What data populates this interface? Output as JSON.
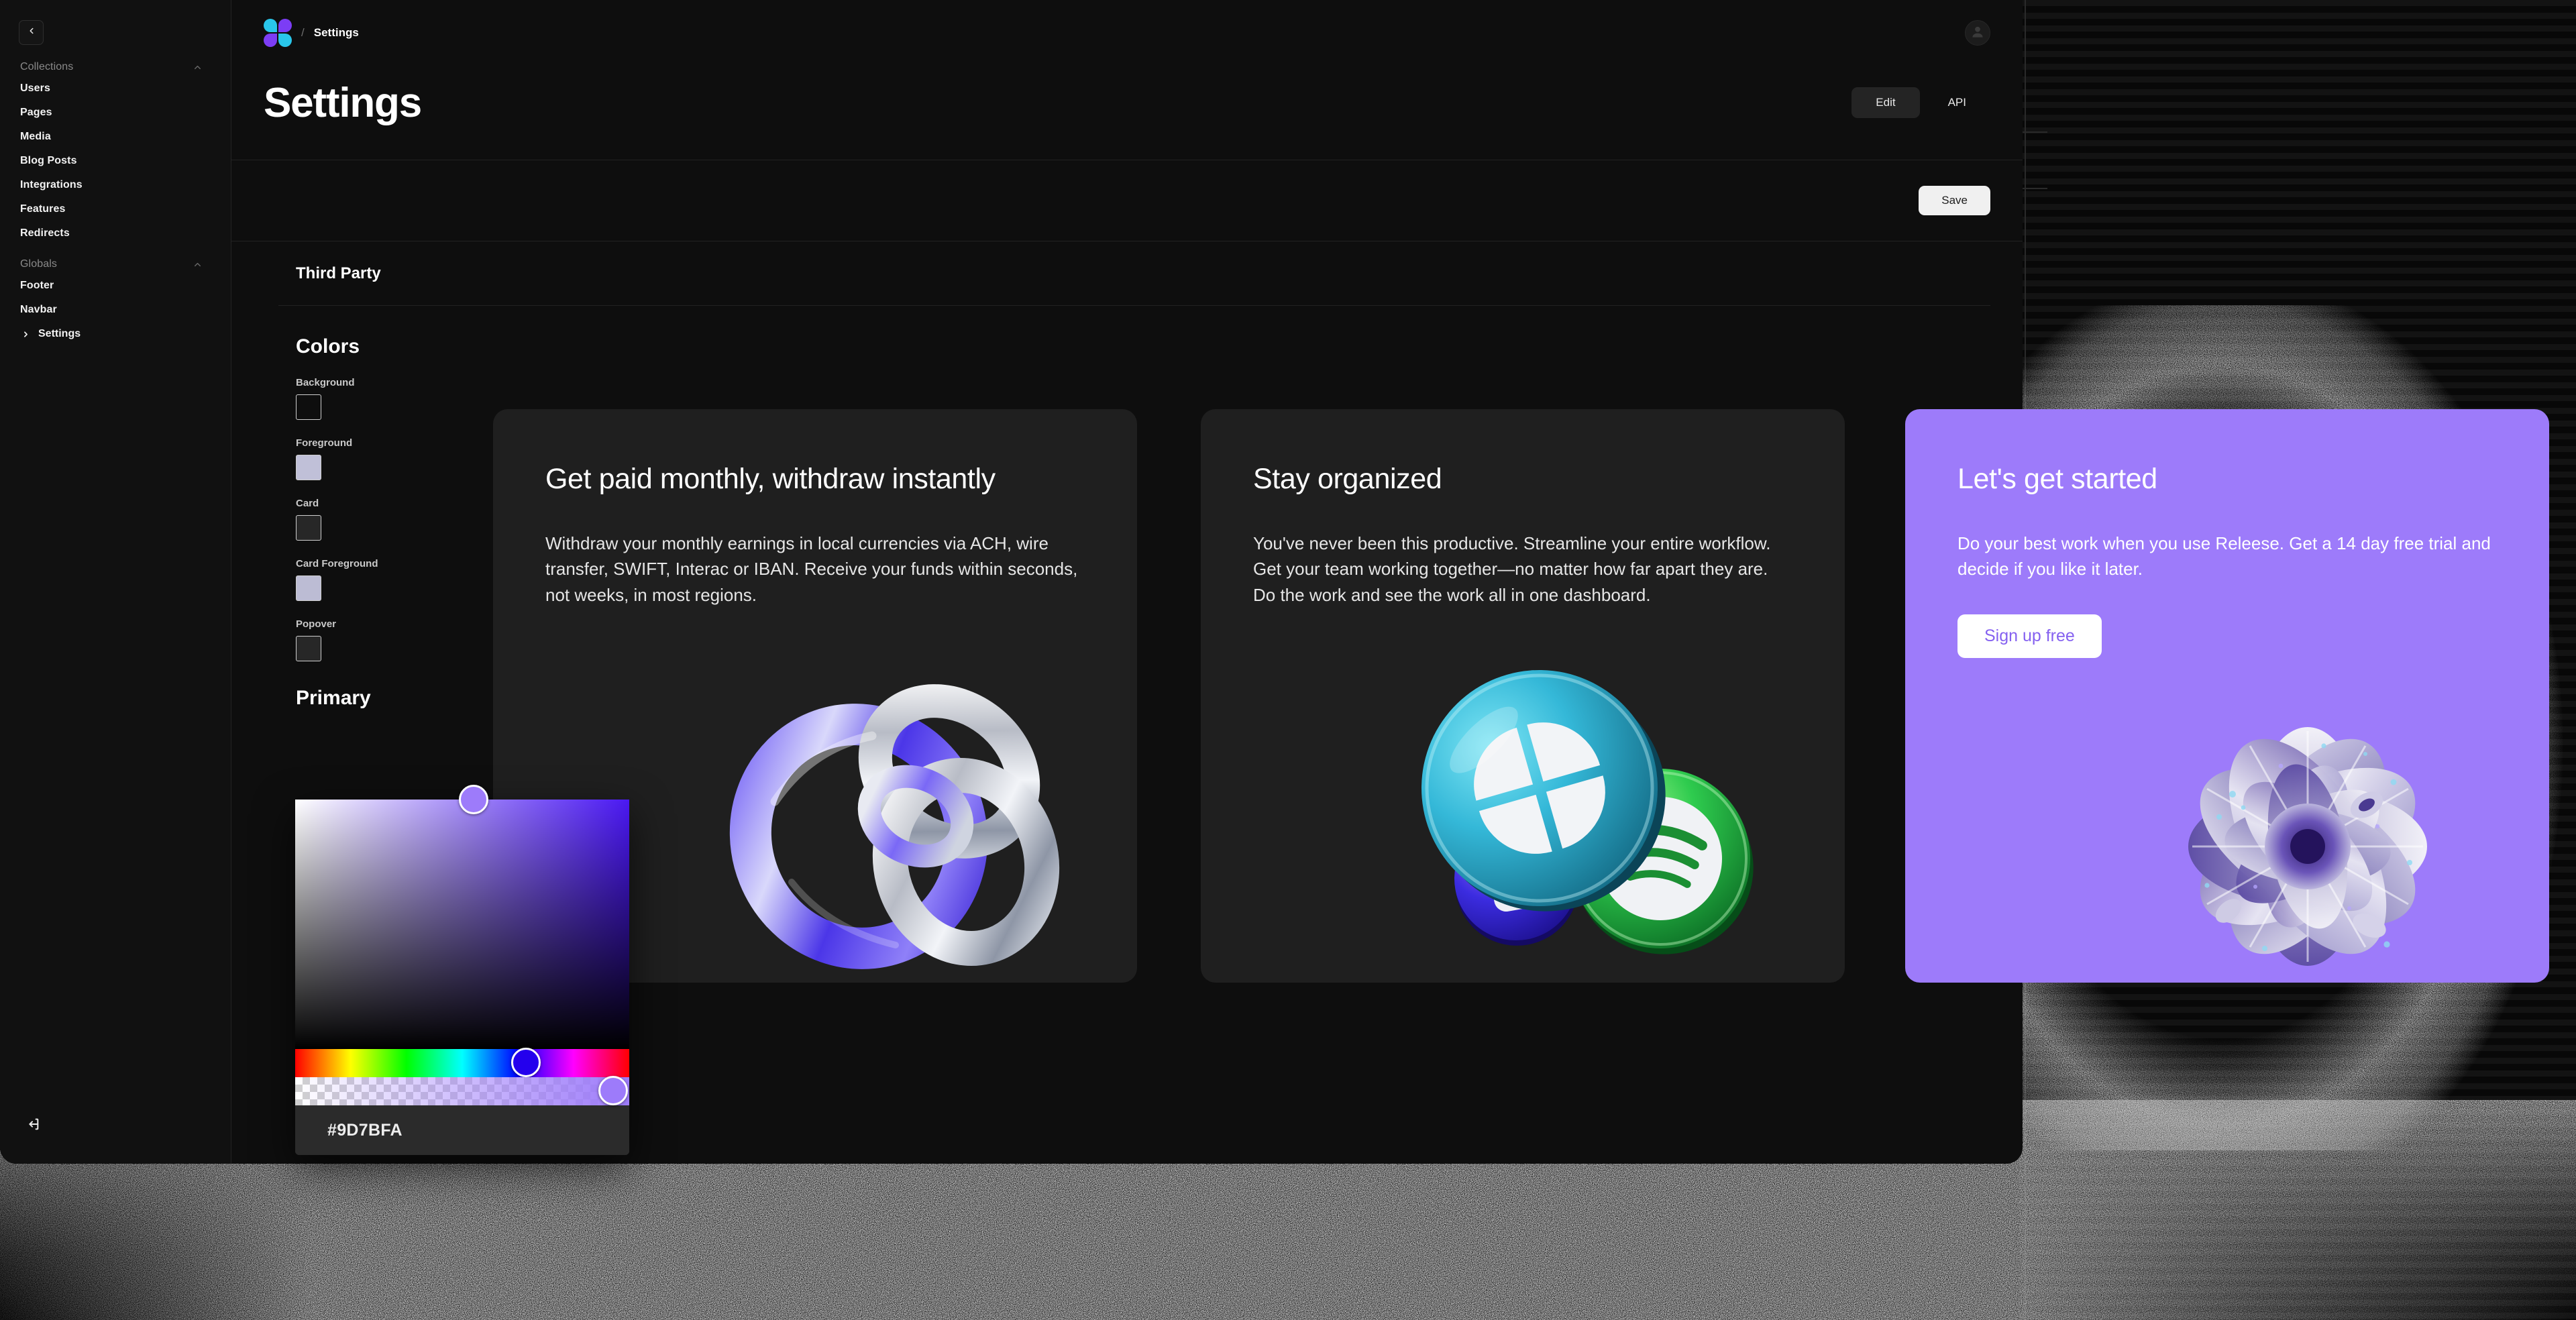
{
  "app": {
    "window_title": "Settings"
  },
  "sidebar": {
    "collapse_icon": "chevron-left-icon",
    "logout_icon": "logout-icon",
    "groups": [
      {
        "label": "Collections",
        "chevron": "chevron-up-icon",
        "items": [
          {
            "label": "Users"
          },
          {
            "label": "Pages"
          },
          {
            "label": "Media"
          },
          {
            "label": "Blog Posts"
          },
          {
            "label": "Integrations"
          },
          {
            "label": "Features"
          },
          {
            "label": "Redirects"
          }
        ]
      },
      {
        "label": "Globals",
        "chevron": "chevron-up-icon",
        "items": [
          {
            "label": "Footer"
          },
          {
            "label": "Navbar"
          }
        ],
        "expandable_items": [
          {
            "label": "Settings",
            "chevron": "chevron-right-icon"
          }
        ]
      }
    ]
  },
  "topbar": {
    "logo_icon": "releese-logo-icon",
    "breadcrumb_separator": "/",
    "breadcrumb_current": "Settings",
    "avatar_icon": "user-avatar-icon"
  },
  "header": {
    "page_title": "Settings",
    "tabs": [
      {
        "label": "Edit",
        "active": true
      },
      {
        "label": "API",
        "active": false
      }
    ]
  },
  "toolbar": {
    "save_label": "Save"
  },
  "sections": {
    "third_party_title": "Third Party",
    "colors_title": "Colors",
    "primary_title": "Primary"
  },
  "colors": {
    "fields": [
      {
        "label": "Background",
        "value": "#0e0e0e"
      },
      {
        "label": "Foreground",
        "value": "#c0c0d8"
      },
      {
        "label": "Card",
        "value": "#272727"
      },
      {
        "label": "Card Foreground",
        "value": "#bcbcd4"
      },
      {
        "label": "Popover",
        "value": "#272727"
      }
    ]
  },
  "color_picker": {
    "hex_value": "#9D7BFA",
    "base_hue_color": "#4A18F2",
    "saturation_knob_color": "#9D7BFA",
    "hue_knob_color": "#2400ED",
    "alpha_knob_color": "#9D7BFA"
  },
  "promo_cards": [
    {
      "title": "Get paid monthly, withdraw instantly",
      "body": "Withdraw your monthly earnings in local currencies via ACH, wire transfer, SWIFT, Interac or IBAN. Receive your funds within seconds, not weeks, in most regions.",
      "background": "#1f1f1f",
      "graphic": "blue-chrome-torus-knot-3d"
    },
    {
      "title": "Stay organized",
      "body": "You've never been this productive. Streamline your entire workflow. Get your team working together—no matter how far apart they are. Do the work and see the work all in one dashboard.",
      "background": "#1f1f1f",
      "graphic": "glassy-platform-coins-3d"
    },
    {
      "title": "Let's get started",
      "body": "Do your best work when you use Releese. Get a 14 day free trial and decide if you like it later.",
      "background": "#9D7BFA",
      "cta_label": "Sign up free",
      "cta_text_color": "#8561F0",
      "graphic": "chrome-flower-3d"
    }
  ]
}
